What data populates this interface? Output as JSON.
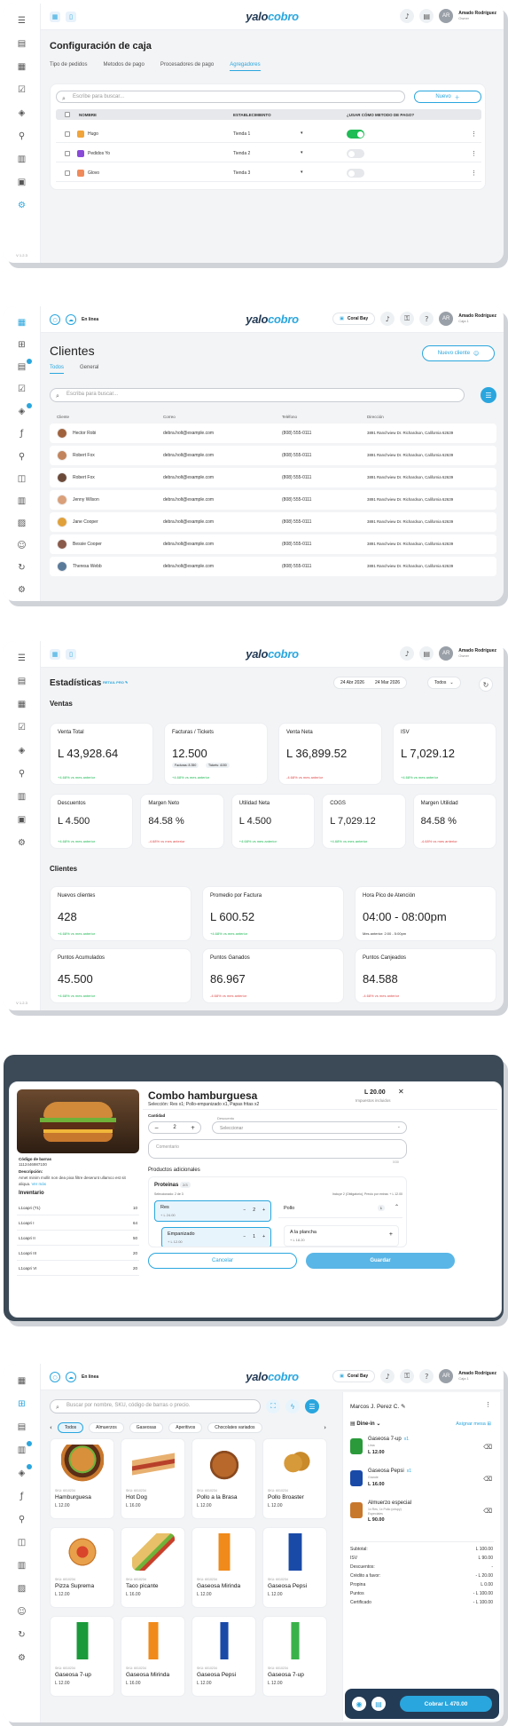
{
  "brand": {
    "logo_a": "yalo",
    "logo_b": "cobro",
    "accent": "#2aa6de",
    "dark": "#243b55"
  },
  "user": {
    "name": "Amado Rodríguez",
    "role": "Owner",
    "initials": "AR",
    "role2": "Caja 1"
  },
  "p1": {
    "title": "Configuración de caja",
    "tabs": [
      "Tipo de pedidos",
      "Metodos de pago",
      "Procesadores de pago",
      "Agregadores"
    ],
    "search_placeholder": "Escribe para buscar...",
    "new_label": "Nuevo",
    "headers": [
      "NOMBRE",
      "ESTABLECIMIENTO",
      "¿USAR CÓMO METODO DE PAGO?"
    ],
    "rows": [
      {
        "name": "Hugo",
        "store": "Tienda 1",
        "on": true
      },
      {
        "name": "Pedidos Yo",
        "store": "Tienda 2",
        "on": false
      },
      {
        "name": "Glovo",
        "store": "Tienda 3",
        "on": false
      }
    ],
    "version": "V 1.2.3"
  },
  "p2": {
    "status": "En línea",
    "store": "Coral Bay",
    "title": "Clientes",
    "new_label": "Nuevo cliente",
    "tabs": [
      "Todos",
      "General"
    ],
    "search_placeholder": "Escriba para buscar...",
    "headers": [
      "Cliente",
      "Correo",
      "Teléfono",
      "Dirección"
    ],
    "rows": [
      {
        "name": "Hector Robi",
        "email": "debra.holt@example.com",
        "phone": "(808) 555-0111",
        "addr": "3891 Ranchview Dr. Richardson, California 62639"
      },
      {
        "name": "Robert Fox",
        "email": "debra.holt@example.com",
        "phone": "(808) 555-0111",
        "addr": "3891 Ranchview Dr. Richardson, California 62639"
      },
      {
        "name": "Robert Fox",
        "email": "debra.holt@example.com",
        "phone": "(808) 555-0111",
        "addr": "3891 Ranchview Dr. Richardson, California 62639"
      },
      {
        "name": "Jenny Wilson",
        "email": "debra.holt@example.com",
        "phone": "(808) 555-0111",
        "addr": "3891 Ranchview Dr. Richardson, California 62639"
      },
      {
        "name": "Jane Cooper",
        "email": "debra.holt@example.com",
        "phone": "(808) 555-0111",
        "addr": "3891 Ranchview Dr. Richardson, California 62639"
      },
      {
        "name": "Bessie Cooper",
        "email": "debra.holt@example.com",
        "phone": "(808) 555-0111",
        "addr": "3891 Ranchview Dr. Richardson, California 62639"
      },
      {
        "name": "Theresa Webb",
        "email": "debra.holt@example.com",
        "phone": "(808) 555-0111",
        "addr": "3891 Ranchview Dr. Richardson, California 62639"
      }
    ]
  },
  "p3": {
    "title": "Estadísticas",
    "store": "RETAIL PRO",
    "date_from": "24 Abr 2026",
    "date_to": "24 Mar 2026",
    "filter": "Todos",
    "ventas_label": "Ventas",
    "clientes_label": "Clientes",
    "row1": [
      {
        "label": "Venta Total",
        "value": "L 43,928.64",
        "chg": "+4.68% vs mes anterior",
        "dir": "up"
      },
      {
        "label": "Facturas / Tickets",
        "value": "12.500",
        "sub1": "Facturas: 8.350",
        "sub2": "Tickets: 4150",
        "chg": "+4.68% vs mes anterior",
        "dir": "up"
      },
      {
        "label": "Venta Neta",
        "value": "L 36,899.52",
        "chg": "-4.68% vs mes anterior",
        "dir": "dn"
      },
      {
        "label": "ISV",
        "value": "L 7,029.12",
        "chg": "+4.68% vs mes anterior",
        "dir": "up"
      }
    ],
    "row2": [
      {
        "label": "Descuentos",
        "value": "L 4.500",
        "chg": "+4.68% vs mes anterior",
        "dir": "up"
      },
      {
        "label": "Margen Neto",
        "value": "84.58 %",
        "chg": "-4.68% vs mes anterior",
        "dir": "dn"
      },
      {
        "label": "Utilidad Neta",
        "value": "L 4.500",
        "chg": "+4.68% vs mes anterior",
        "dir": "up"
      },
      {
        "label": "COGS",
        "value": "L 7,029.12",
        "chg": "+4.68% vs mes anterior",
        "dir": "up"
      },
      {
        "label": "Margen Utilidad",
        "value": "84.58 %",
        "chg": "-4.68% vs mes anterior",
        "dir": "dn"
      }
    ],
    "row3": [
      {
        "label": "Nuevos clientes",
        "value": "428",
        "chg": "+4.68% vs mes anterior",
        "dir": "up"
      },
      {
        "label": "Promedio por Factura",
        "value": "L 600.52",
        "chg": "+4.68% vs mes anterior",
        "dir": "up"
      },
      {
        "label": "Hora Pico de Atención",
        "value": "04:00 - 08:00pm",
        "chg": "Mes anterior: 2:00 - 5:00pm",
        "dir": "none"
      }
    ],
    "row4": [
      {
        "label": "Puntos Acumulados",
        "value": "45.500",
        "chg": "+4.68% vs mes anterior",
        "dir": "up"
      },
      {
        "label": "Puntos Ganados",
        "value": "86.967",
        "chg": "-4.68% vs mes anterior",
        "dir": "dn"
      },
      {
        "label": "Puntos Canjeados",
        "value": "84.588",
        "chg": "-4.68% vs mes anterior",
        "dir": "dn"
      }
    ]
  },
  "p4": {
    "title": "Combo hamburguesa",
    "price": "L 20.00",
    "tax_note": "Impuestos incluidos",
    "selection": "Selección: Res x1; Pollo-empanizado x1, Papas fritas x2",
    "barcode_label": "Código de barras",
    "barcode": "1112446987100",
    "desc_label": "Descripción:",
    "desc": "Amet minim mollit non dea pixa filtre deserunt ullamco est sit aliqua.",
    "see_more": "Ver más",
    "inv_label": "Inventario",
    "inventory": [
      {
        "n": "L1oapri (T1)",
        "v": "10"
      },
      {
        "n": "L1oapri I",
        "v": "64"
      },
      {
        "n": "L1oapri II",
        "v": "50"
      },
      {
        "n": "L1oapri III",
        "v": "20"
      },
      {
        "n": "L1oapri VI",
        "v": "20"
      }
    ],
    "qty_label": "Cantidad",
    "qty": "2",
    "disc_label": "Descuento",
    "disc_ph": "Seleccionar",
    "comment_ph": "Comentario",
    "comment_count": "0/30",
    "extras_label": "Productos adicionales",
    "group": "Proteinas",
    "group_count": "2/3",
    "group_sel": "Seleccionado: 2 de 3",
    "group_note": "Incluye 2 (Obligatorio), Precio por extras: + L 12.00",
    "opt1": {
      "name": "Res",
      "price": "+ L 24.00",
      "qty": "2"
    },
    "opt2": {
      "name": "Empanizado",
      "price": "+ L 12.00",
      "qty": "1"
    },
    "opt3": {
      "name": "Pollo",
      "count": "1"
    },
    "opt4": {
      "name": "A la plancha",
      "price": "+ L 18.20"
    },
    "cancel": "Cancelar",
    "save": "Guardar"
  },
  "p5": {
    "status": "En línea",
    "store": "Coral Bay",
    "search_ph": "Buscar por nombre, SKU, código de barras o precio.",
    "cats": [
      "Todos",
      "Almuerzos",
      "Gaseosas",
      "Aperitivos",
      "Chocolates variados"
    ],
    "products": [
      {
        "sku": "SKU: 6010234",
        "name": "Hamburguesa",
        "price": "L 12.00"
      },
      {
        "sku": "SKU: 6010234",
        "name": "Hot Dog",
        "price": "L 16.00"
      },
      {
        "sku": "SKU: 6010234",
        "name": "Pollo a la Brasa",
        "price": "L 12.00"
      },
      {
        "sku": "SKU: 6010234",
        "name": "Pollo Broaster",
        "price": "L 12.00"
      },
      {
        "sku": "SKU: 6010234",
        "name": "Pizza Suprema",
        "price": "L 12.00"
      },
      {
        "sku": "SKU: 6010234",
        "name": "Taco picante",
        "price": "L 16.00"
      },
      {
        "sku": "SKU: 6010234",
        "name": "Gaseosa Mirinda",
        "price": "L 12.00"
      },
      {
        "sku": "SKU: 6010234",
        "name": "Gaseosa Pepsi",
        "price": "L 12.00"
      },
      {
        "sku": "SKU: 6010234",
        "name": "Gaseosa 7-up",
        "price": "L 12.00"
      },
      {
        "sku": "SKU: 6010234",
        "name": "Gaseosa Mirinda",
        "price": "L 16.00"
      },
      {
        "sku": "SKU: 6010234",
        "name": "Gaseosa Pepsi",
        "price": "L 12.00"
      },
      {
        "sku": "SKU: 6010234",
        "name": "Gaseosa 7-up",
        "price": "L 12.00"
      }
    ],
    "customer": "Marcos J. Perez C.",
    "order_type": "Dine-in",
    "assign": "Asignar mesa",
    "items": [
      {
        "name": "Gaseosa 7-up",
        "qty": "x1",
        "note": "Lima",
        "price": "L 12.00"
      },
      {
        "name": "Gaseosa Pepsi",
        "qty": "x1",
        "note": "Grande",
        "price": "L 16.00"
      },
      {
        "name": "Almuerzo especial",
        "qty": "",
        "note": "1x Res, 1x Pollo (crispy)",
        "note2": "Especiales",
        "price": "L 90.00"
      }
    ],
    "totals": [
      {
        "k": "Subtotal:",
        "v": "L 100.00"
      },
      {
        "k": "ISV",
        "v": "L 90.00"
      },
      {
        "k": "Descuentos:",
        "v": "-"
      },
      {
        "k": "Crédito a favor:",
        "v": "- L 20.00"
      },
      {
        "k": "Propina",
        "v": "L 0.00"
      },
      {
        "k": "Puntos",
        "v": "- L 100.00"
      },
      {
        "k": "Certificado",
        "v": "- L 100.00"
      }
    ],
    "pay_label": "Cobrar L 470.00"
  }
}
